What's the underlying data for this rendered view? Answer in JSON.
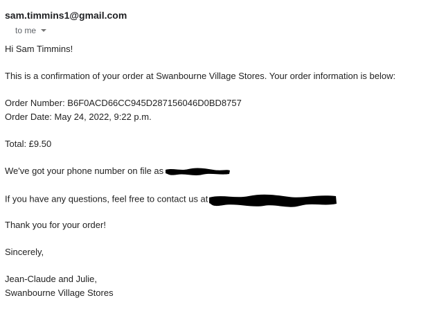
{
  "email": {
    "sender": "sam.timmins1@gmail.com",
    "recipient": "to me",
    "icons": {
      "recipient_details": "chevron-down-icon",
      "redaction": "scribble-redaction"
    },
    "colors": {
      "sender": "#202124",
      "recipient": "#5f6368",
      "body": "#222222",
      "redaction": "#000000"
    },
    "body": {
      "greeting": "Hi Sam Timmins!",
      "intro": "This is a confirmation of your order at Swanbourne Village Stores. Your order information is below:",
      "order_number": "Order Number: B6F0ACD66CC945D287156046D0BD8757",
      "order_date": "Order Date: May 24, 2022, 9:22 p.m.",
      "total": "Total: £9.50",
      "phone_text": "We've got your phone number on file as",
      "contact_text": "If you have any questions, feel free to contact us at",
      "thanks": "Thank you for your order!",
      "sign_off": "Sincerely,",
      "signature_names": "Jean-Claude and Julie,",
      "signature_store": "Swanbourne Village Stores"
    }
  }
}
